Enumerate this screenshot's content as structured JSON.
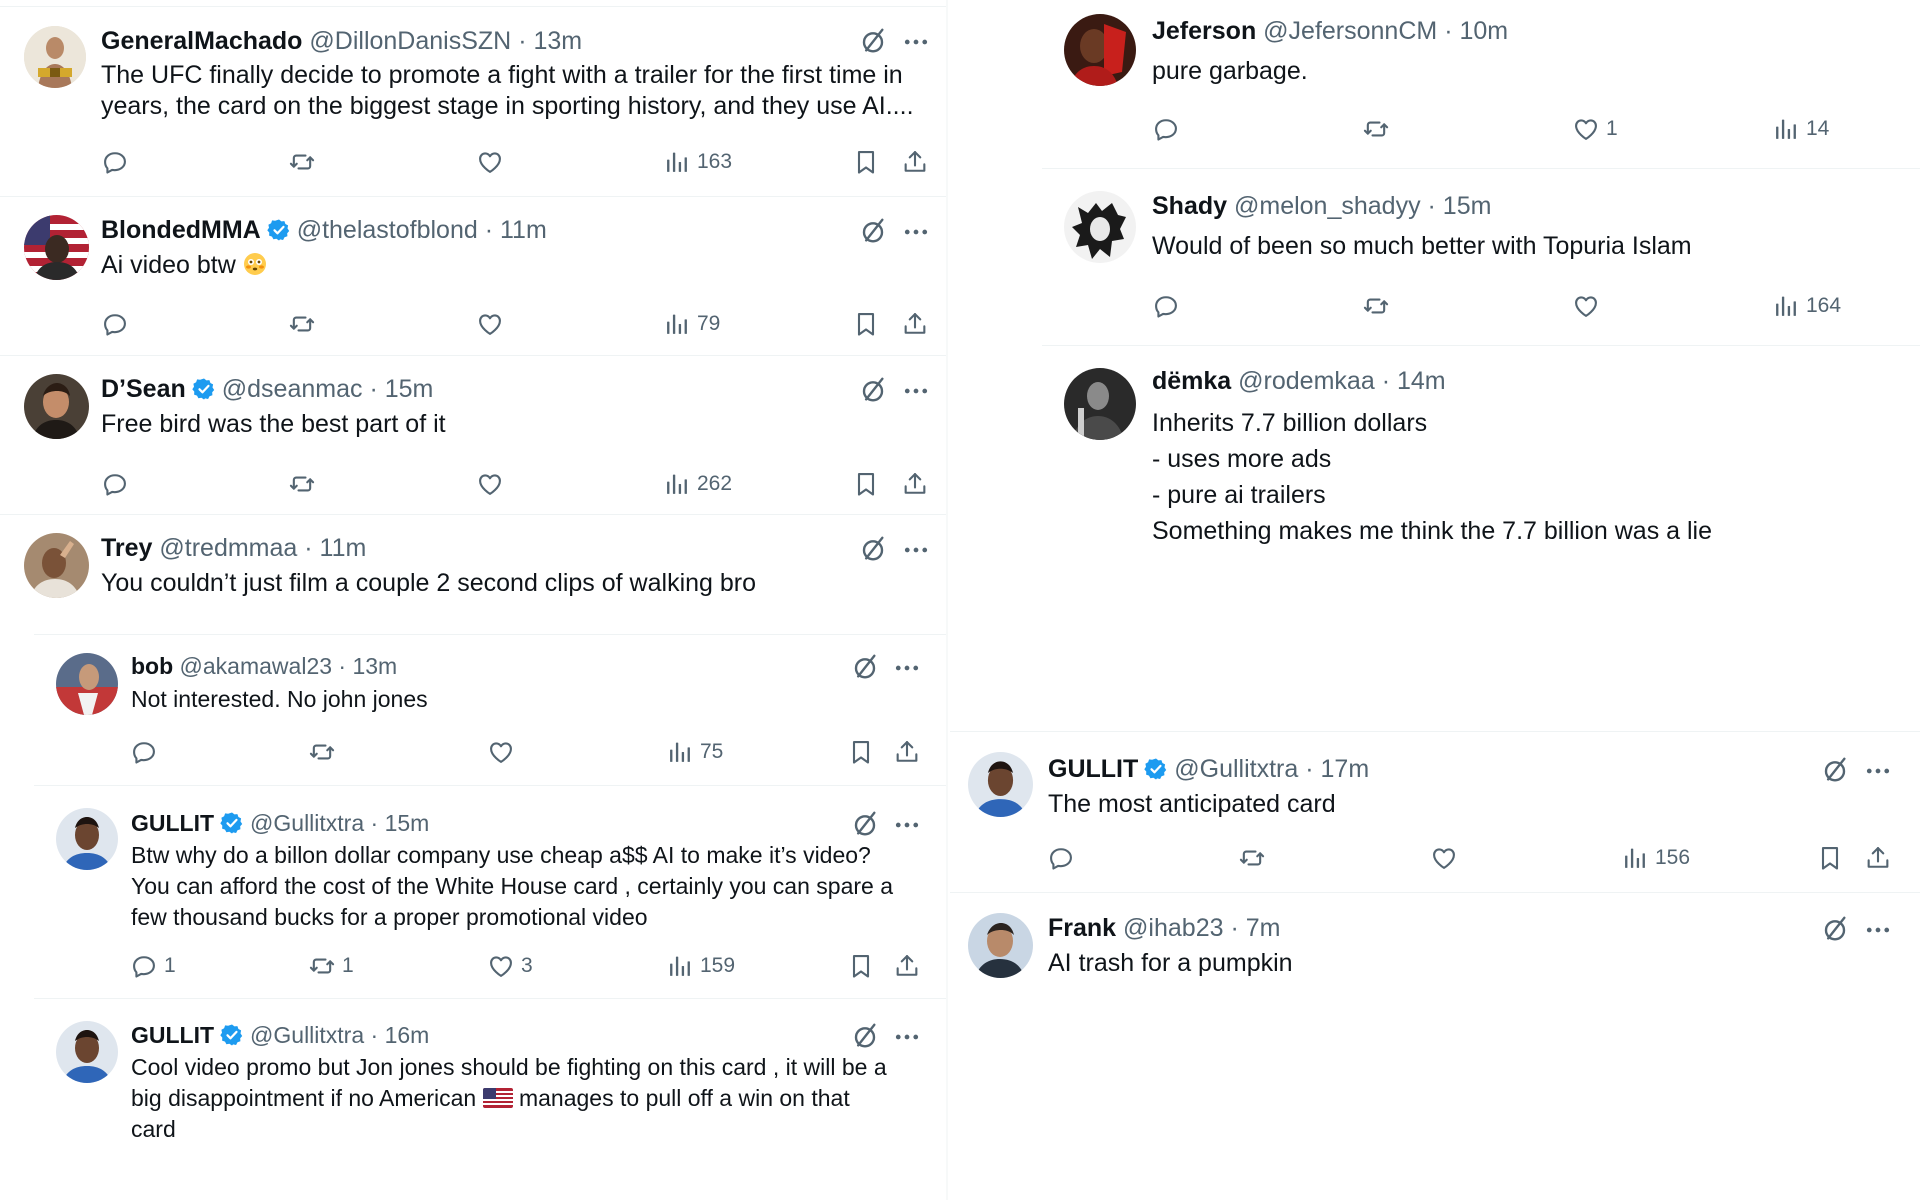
{
  "left": {
    "tweets": [
      {
        "name": "GeneralMachado",
        "handle": "@DillonDanisSZN",
        "time": "· 13m",
        "lines": [
          "The UFC finally decide to promote a fight with a trailer for the first time in",
          "years, the card on the biggest stage in sporting history, and they use AI...."
        ],
        "replies": "",
        "reposts": "",
        "likes": "",
        "views": "163"
      },
      {
        "name": "BlondedMMA",
        "handle": "@thelastofblond",
        "time": "· 11m",
        "lines": [
          "Ai video btw"
        ],
        "replies": "",
        "reposts": "",
        "likes": "",
        "views": "79"
      },
      {
        "name": "D’Sean",
        "handle": "@dseanmac",
        "time": "· 15m",
        "lines": [
          "Free bird was the best part of it"
        ],
        "replies": "",
        "reposts": "",
        "likes": "",
        "views": "262"
      },
      {
        "name": "Trey",
        "handle": "@tredmmaa",
        "time": "· 11m",
        "lines": [
          "You couldn’t just film a couple 2 second clips of walking bro"
        ]
      },
      {
        "name": "bob",
        "handle": "@akamawal23",
        "time": "· 13m",
        "lines": [
          "Not interested. No john jones"
        ],
        "replies": "",
        "reposts": "",
        "likes": "",
        "views": "75"
      },
      {
        "name": "GULLIT",
        "handle": "@Gullitxtra",
        "time": "· 15m",
        "lines": [
          "Btw why do a billon dollar company use cheap a$$ AI to make it’s video?",
          "You can afford the cost of the White House card , certainly you can spare a",
          "few thousand bucks for a proper promotional video"
        ],
        "replies": "1",
        "reposts": "1",
        "likes": "3",
        "views": "159"
      },
      {
        "name": "GULLIT",
        "handle": "@Gullitxtra",
        "time": "· 16m",
        "lines": [
          "Cool video promo but Jon jones should be fighting on this card , it will be a",
          "big disappointment if no American",
          "manages to pull off a win on that",
          "card"
        ]
      }
    ]
  },
  "right": {
    "tweets": [
      {
        "name": "Jeferson",
        "handle": "@JefersonnCM",
        "time": "· 10m",
        "lines": [
          "pure garbage."
        ],
        "replies": "",
        "reposts": "",
        "likes": "1",
        "views": "14"
      },
      {
        "name": "Shady",
        "handle": "@melon_shadyy",
        "time": "· 15m",
        "lines": [
          "Would of been so much better with Topuria Islam"
        ],
        "replies": "",
        "reposts": "",
        "likes": "",
        "views": "164"
      },
      {
        "name": "dëmka",
        "handle": "@rodemkaa",
        "time": "· 14m",
        "lines": [
          "Inherits 7.7 billion dollars",
          "",
          "- uses more ads",
          "- pure ai trailers",
          "",
          "Something makes me think the 7.7 billion was a lie"
        ]
      },
      {
        "name": "GULLIT",
        "handle": "@Gullitxtra",
        "time": "· 17m",
        "lines": [
          "The most anticipated card"
        ],
        "replies": "",
        "reposts": "",
        "likes": "",
        "views": "156"
      },
      {
        "name": "Frank",
        "handle": "@ihab23",
        "time": "· 7m",
        "lines": [
          "AI trash for a pumpkin"
        ]
      }
    ]
  },
  "colors": {
    "verified": "#1d9bf0",
    "icon_gray": "#536471",
    "text": "#0f1419",
    "divider": "#eff3f4"
  }
}
